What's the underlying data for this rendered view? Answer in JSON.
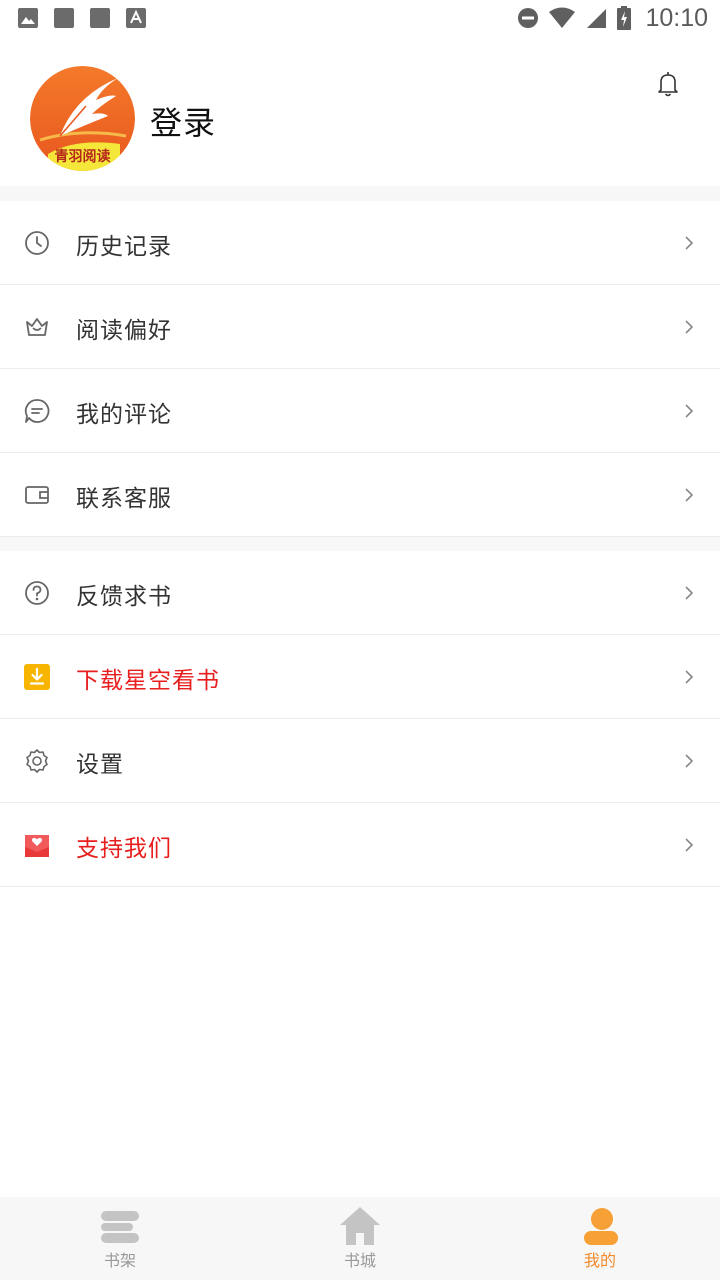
{
  "status_bar": {
    "time": "10:10",
    "icons": [
      "image-icon",
      "square-icon",
      "square-icon",
      "a-icon",
      "do-not-disturb-icon",
      "wifi-icon",
      "signal-icon",
      "battery-icon"
    ]
  },
  "profile": {
    "avatar_text": "青羽阅读",
    "login_label": "登录",
    "bell_icon": "bell-icon"
  },
  "menu_group_1": [
    {
      "label": "历史记录",
      "icon": "clock-icon"
    },
    {
      "label": "阅读偏好",
      "icon": "crown-icon"
    },
    {
      "label": "我的评论",
      "icon": "comment-icon"
    },
    {
      "label": "联系客服",
      "icon": "wallet-icon"
    }
  ],
  "menu_group_2": [
    {
      "label": "反馈求书",
      "icon": "question-icon"
    },
    {
      "label": "下载星空看书",
      "icon": "download-icon",
      "color": "#e81d1d"
    },
    {
      "label": "设置",
      "icon": "gear-icon"
    },
    {
      "label": "支持我们",
      "icon": "heart-envelope-icon",
      "color": "#e81d1d"
    }
  ],
  "bottom_nav": [
    {
      "label": "书架",
      "icon": "bookshelf-icon",
      "active": false
    },
    {
      "label": "书城",
      "icon": "home-icon",
      "active": false
    },
    {
      "label": "我的",
      "icon": "person-icon",
      "active": true
    }
  ],
  "colors": {
    "accent": "#f28a2b",
    "red": "#e81d1d",
    "icon_gray": "#777777"
  }
}
